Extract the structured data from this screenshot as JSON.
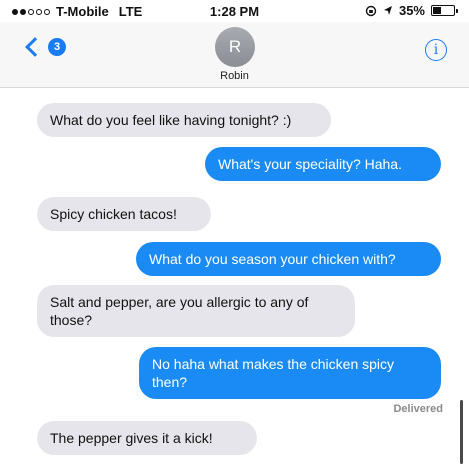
{
  "status_bar": {
    "carrier": "T-Mobile",
    "network": "LTE",
    "time": "1:28 PM",
    "battery_text": "35%",
    "battery_level": 0.35,
    "icons": [
      "signal-dots",
      "lock-rotation-icon",
      "location-arrow-icon",
      "battery-icon"
    ]
  },
  "header": {
    "back_badge": "3",
    "avatar_initial": "R",
    "contact_name": "Robin",
    "info_icon": "i"
  },
  "messages": [
    {
      "dir": "in",
      "text": "What do you feel like having tonight? :)"
    },
    {
      "dir": "out",
      "text": "What's your speciality? Haha."
    },
    {
      "dir": "in",
      "text": "Spicy chicken tacos!"
    },
    {
      "dir": "out",
      "text": "What do you season your chicken with?"
    },
    {
      "dir": "in",
      "text": "Salt and pepper, are you allergic to any of those?"
    },
    {
      "dir": "out",
      "text": "No haha what makes the chicken spicy then?"
    },
    {
      "dir": "in",
      "text": "The pepper gives it a kick!"
    }
  ],
  "delivered_label": "Delivered",
  "colors": {
    "accent": "#1a7cf5",
    "outgoing_bubble": "#1a8bf5",
    "incoming_bubble": "#e6e5eb"
  }
}
